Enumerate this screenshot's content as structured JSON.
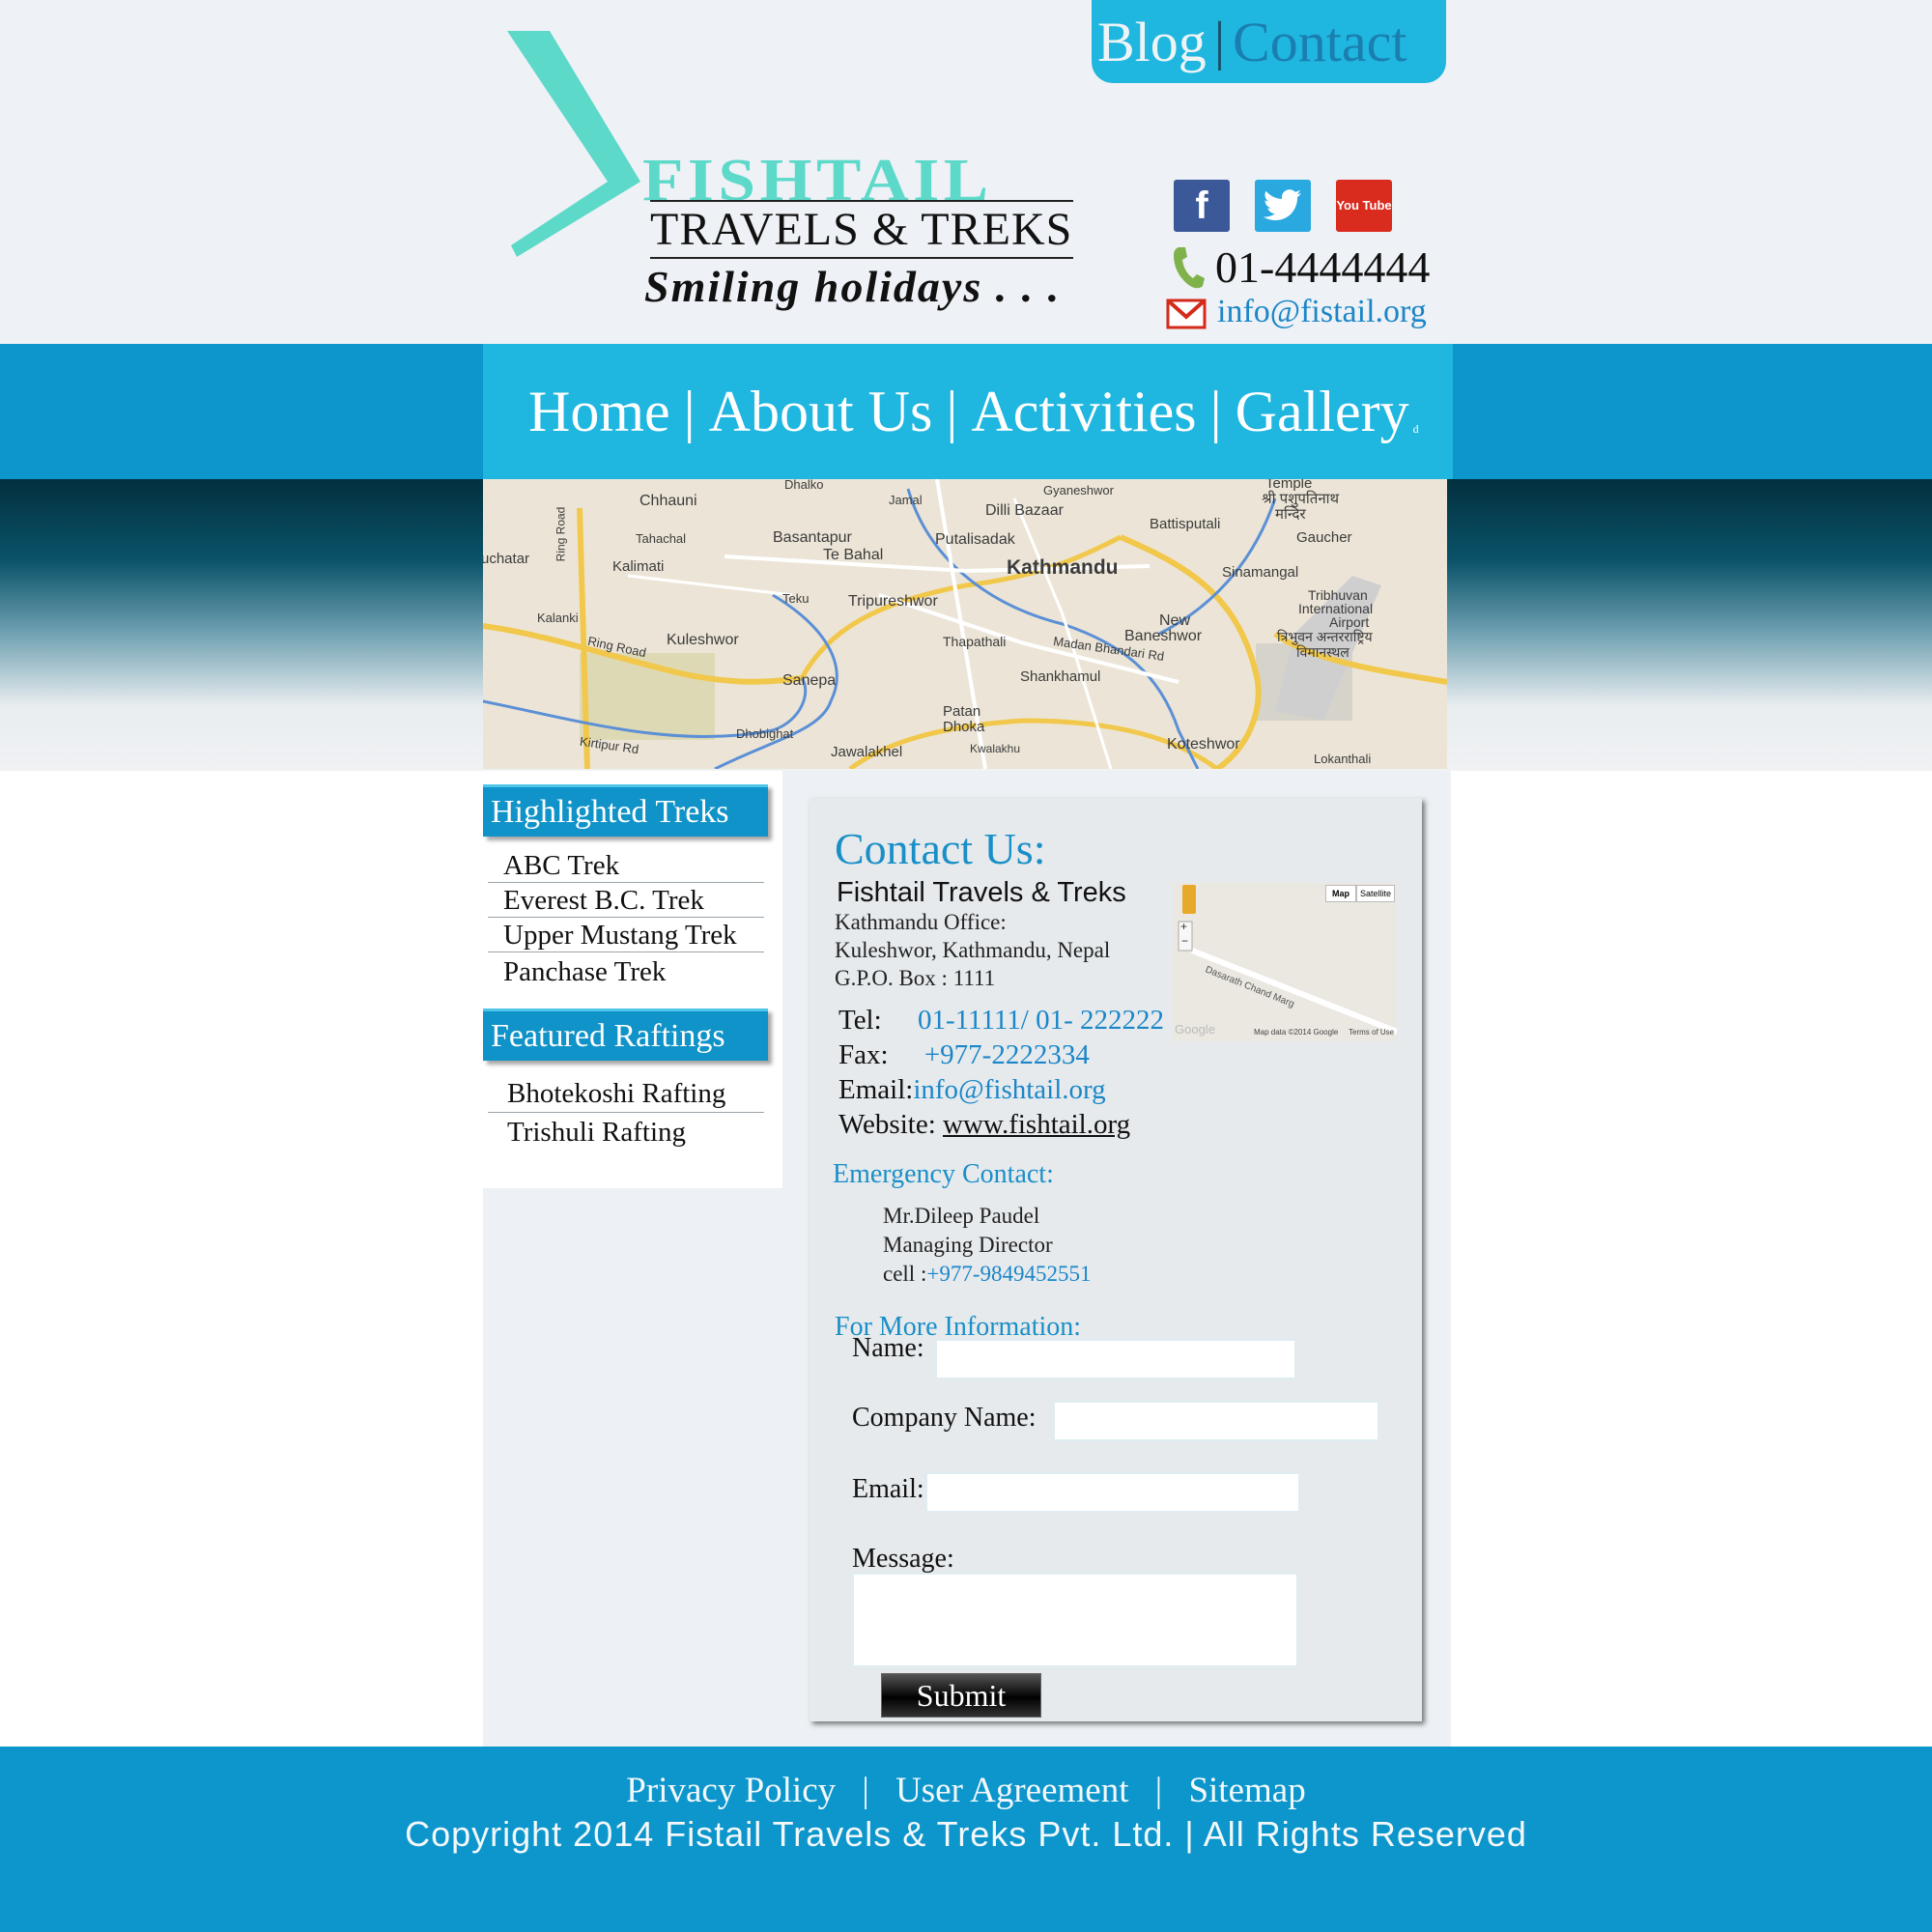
{
  "header": {
    "top_links": {
      "blog": "Blog",
      "separator": "|",
      "contact": "Contact"
    },
    "logo": {
      "brand": "FISHTAIL",
      "subtitle": "TRAVELS & TREKS",
      "tagline": "Smiling holidays . . ."
    },
    "social": [
      {
        "name": "facebook-icon",
        "glyph": "f"
      },
      {
        "name": "twitter-icon",
        "glyph": "t"
      },
      {
        "name": "youtube-icon",
        "glyph": "You Tube"
      }
    ],
    "phone": "01-4444444",
    "email": "info@fistail.org"
  },
  "nav": {
    "items": [
      "Home",
      "About Us",
      "Activities",
      "Gallery"
    ],
    "separator": "|",
    "stray_mark": "d"
  },
  "map": {
    "labels": [
      "Dhalko",
      "Gyaneshwor",
      "Temple",
      "श्री पशुपतिनाथ",
      "मन्दिर",
      "Chhauni",
      "Jamal",
      "Dilli Bazaar",
      "Battisputali",
      "Gaucher",
      "Tahachal",
      "Basantapur",
      "Putalisadak",
      "Te Bahal",
      "Kathmandu",
      "Sinamangal",
      "uchatar",
      "Kalimati",
      "Teku",
      "Tripureshwor",
      "Tribhuvan",
      "International",
      "Airport",
      "Kalanki",
      "New",
      "Baneshwor",
      "त्रिभुवन अन्तरराष्ट्रिय",
      "विमानस्थल",
      "Kuleshwor",
      "Thapathali",
      "Madan Bhandari Rd",
      "Ring Road",
      "Sanepa",
      "Shankhamul",
      "Patan",
      "Dhoka",
      "Dhobighat",
      "Kirtipur Rd",
      "Jawalakhel",
      "Kwalakhu",
      "Koteshwor",
      "Lokanthali",
      "Ring Road"
    ]
  },
  "sidebar": {
    "treks_title": "Highlighted Treks",
    "treks": [
      "ABC Trek",
      "Everest B.C. Trek",
      "Upper Mustang Trek",
      "Panchase Trek"
    ],
    "raftings_title": "Featured Raftings",
    "raftings": [
      "Bhotekoshi Rafting",
      "Trishuli Rafting"
    ]
  },
  "contact": {
    "title": "Contact Us:",
    "company": "Fishtail Travels & Treks",
    "office_label": "Kathmandu Office:",
    "address": "Kuleshwor, Kathmandu, Nepal",
    "po_box": "G.P.O. Box : 1111",
    "tel_label": "Tel:",
    "tel": "01-11111/ 01- 222222",
    "fax_label": "Fax:",
    "fax": "+977-2222334",
    "email_label": "Email:",
    "email": "info@fishtail.org",
    "website_label": "Website:",
    "website": "www.fishtail.org",
    "minimap": {
      "map_btn": "Map",
      "satellite_btn": "Satellite",
      "road": "Dasarath Chand Marg",
      "google": "Google",
      "data": "Map data ©2014 Google",
      "terms": "Terms of Use",
      "zoom_in": "+",
      "zoom_out": "−"
    },
    "emergency_title": "Emergency Contact:",
    "emergency_name": "Mr.Dileep Paudel",
    "emergency_role": "Managing Director",
    "emergency_cell_label": "cell :",
    "emergency_cell": "+977-9849452551",
    "more_title": "For More Information:",
    "form": {
      "name_label": "Name:",
      "company_label": "Company Name:",
      "email_label": "Email:",
      "message_label": "Message:",
      "submit": "Submit"
    }
  },
  "footer": {
    "links": [
      "Privacy Policy",
      "User Agreement",
      "Sitemap"
    ],
    "separator": "|",
    "copyright": "Copyright 2014 Fistail Travels & Treks Pvt. Ltd.  |  All Rights Reserved"
  },
  "colors": {
    "accent": "#1fb6df",
    "nav_band": "#0c96cc",
    "link": "#1a86c8",
    "logo_teal": "#5dd9c9"
  }
}
